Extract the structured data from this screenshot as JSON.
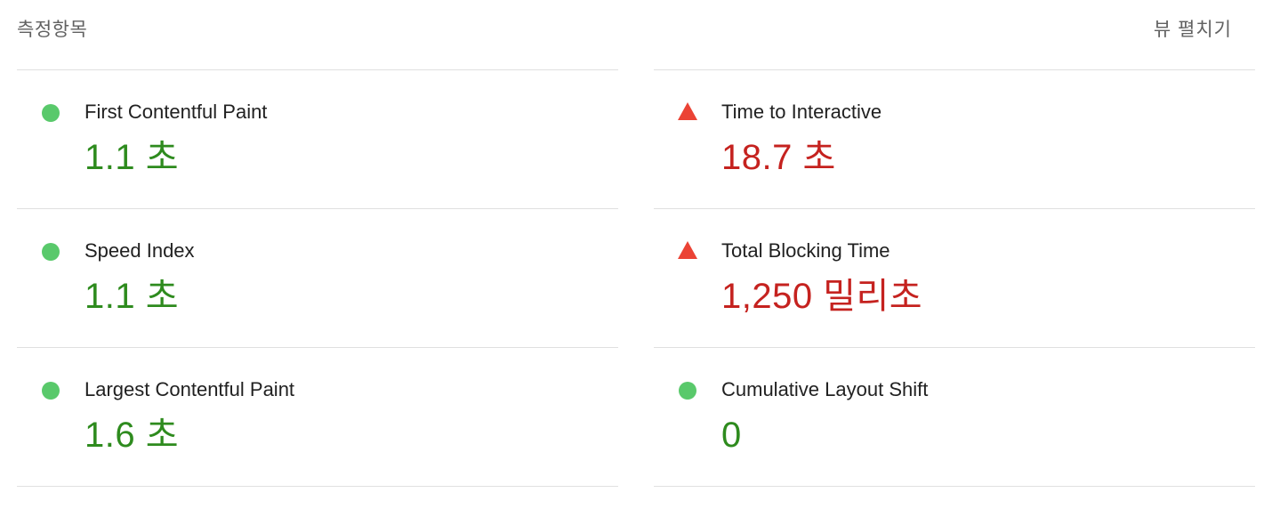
{
  "header": {
    "title": "측정항목",
    "toggle_label": "뷰 펼치기"
  },
  "colors": {
    "good": "#2e8b1e",
    "bad": "#c5221f",
    "pass_indicator": "#59c96b",
    "fail_indicator": "#eb4335"
  },
  "metrics": [
    {
      "label": "First Contentful Paint",
      "value": "1.1 초",
      "status": "pass",
      "indicator": "green-circle-icon"
    },
    {
      "label": "Time to Interactive",
      "value": "18.7 초",
      "status": "fail",
      "indicator": "red-triangle-icon"
    },
    {
      "label": "Speed Index",
      "value": "1.1 초",
      "status": "pass",
      "indicator": "green-circle-icon"
    },
    {
      "label": "Total Blocking Time",
      "value": "1,250 밀리초",
      "status": "fail",
      "indicator": "red-triangle-icon"
    },
    {
      "label": "Largest Contentful Paint",
      "value": "1.6 초",
      "status": "pass",
      "indicator": "green-circle-icon"
    },
    {
      "label": "Cumulative Layout Shift",
      "value": "0",
      "status": "pass",
      "indicator": "green-circle-icon"
    }
  ]
}
